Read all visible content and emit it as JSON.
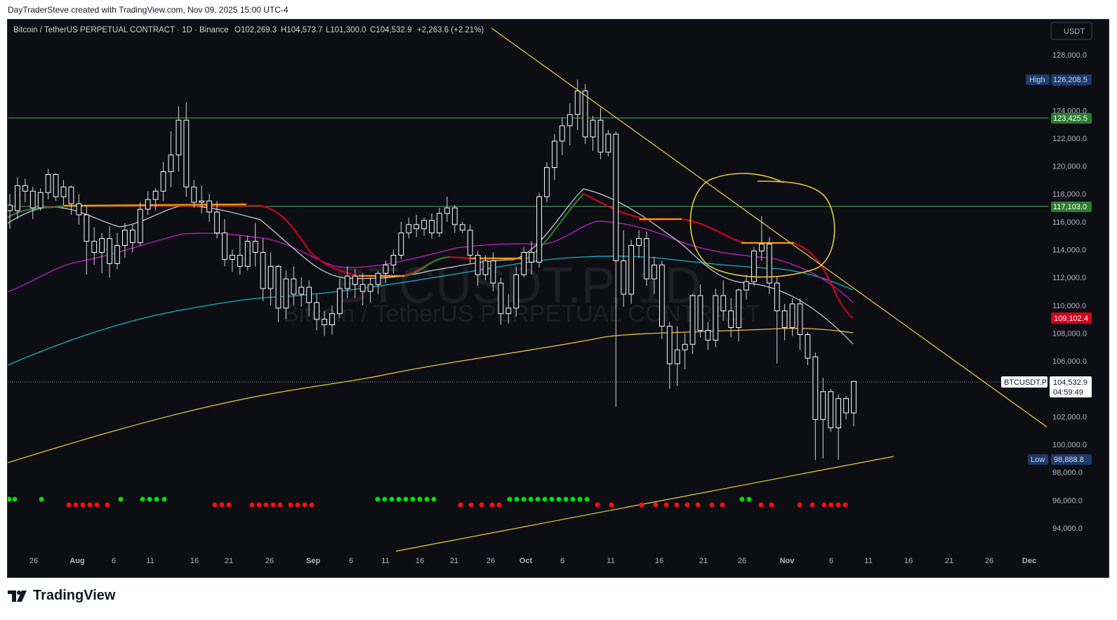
{
  "header": {
    "credit": "DayTraderSteve created with TradingView.com, Nov 09, 2025 15:00 UTC-4"
  },
  "legend": {
    "symbol": "Bitcoin / TetherUS PERPETUAL CONTRACT · 1D · Binance",
    "open": "O102,269.3",
    "high": "H104,573.7",
    "low": "L101,300.0",
    "close": "C104,532.9",
    "change": "+2,263.6 (+2.21%)"
  },
  "currency_button": "USDT",
  "watermark": {
    "ticker": "BTCUSDT.P, 1D",
    "name": "Bitcoin / TetherUS PERPETUAL CONTRACT"
  },
  "labels": {
    "high_tag": "High",
    "high_value": "126,208.5",
    "low_tag": "Low",
    "low_value": "98,888.8",
    "line_1": "123,425.5",
    "line_2": "117,103.0",
    "ma_red": "109,102.4",
    "symbol_tag": "BTCUSDT.P",
    "last_price": "104,532.9",
    "countdown": "04:59:49"
  },
  "colors": {
    "background": "#0c0e14",
    "up": "#ffffff",
    "down": "#ffffff",
    "trendline": "#f5d33c",
    "level": "#4caf50",
    "ma_red": "#d0021b",
    "ma_orange": "#ff9800",
    "ma_green": "#2e7d32",
    "ma_magenta": "#c51fc5",
    "ma_cyan": "#1ab0c8",
    "ma_yellow": "#e6c440"
  },
  "chart_data": {
    "type": "candlestick",
    "symbol": "BTCUSDT.P",
    "timeframe": "1D",
    "y_ticks": [
      "128,000.0",
      "126,000.0",
      "124,000.0",
      "122,000.0",
      "120,000.0",
      "118,000.0",
      "116,000.0",
      "114,000.0",
      "112,000.0",
      "110,000.0",
      "108,000.0",
      "106,000.0",
      "104,000.0",
      "102,000.0",
      "100,000.0",
      "98,000.0",
      "96,000.0",
      "94,000.0"
    ],
    "x_ticks": [
      "26",
      "Aug",
      "6",
      "11",
      "16",
      "21",
      "26",
      "Sep",
      "6",
      "11",
      "16",
      "21",
      "26",
      "Oct",
      "6",
      "11",
      "16",
      "21",
      "26",
      "Nov",
      "6",
      "11",
      "16",
      "21",
      "26",
      "Dec"
    ],
    "ylim": [
      93000,
      129500
    ],
    "horizontal_levels": [
      123425.5,
      117103.0
    ],
    "last_close": 104532.9,
    "candles": [
      [
        117200,
        118000,
        115500,
        116800
      ],
      [
        116800,
        119200,
        116200,
        118600
      ],
      [
        118600,
        119100,
        117400,
        118200
      ],
      [
        118200,
        118500,
        116200,
        117000
      ],
      [
        117000,
        118400,
        116800,
        118100
      ],
      [
        118100,
        119800,
        117600,
        119400
      ],
      [
        119400,
        119500,
        117500,
        117800
      ],
      [
        117800,
        119000,
        117200,
        118500
      ],
      [
        118500,
        118600,
        116500,
        117300
      ],
      [
        117300,
        118000,
        115800,
        116500
      ],
      [
        116500,
        117200,
        112200,
        114600
      ],
      [
        114600,
        115600,
        112900,
        113800
      ],
      [
        113800,
        115200,
        112300,
        114800
      ],
      [
        114800,
        115700,
        112000,
        113000
      ],
      [
        113000,
        115200,
        112600,
        114300
      ],
      [
        114300,
        115900,
        113400,
        115400
      ],
      [
        115400,
        115800,
        113800,
        114500
      ],
      [
        114500,
        117400,
        114300,
        116900
      ],
      [
        116900,
        118200,
        116500,
        117600
      ],
      [
        117600,
        118400,
        116800,
        118200
      ],
      [
        118200,
        120300,
        117500,
        119600
      ],
      [
        119600,
        122500,
        118500,
        120800
      ],
      [
        120800,
        124300,
        119600,
        123300
      ],
      [
        123300,
        124600,
        117800,
        118500
      ],
      [
        118500,
        119000,
        117000,
        117400
      ],
      [
        117400,
        118600,
        116600,
        117500
      ],
      [
        117500,
        118000,
        116000,
        116700
      ],
      [
        116700,
        117500,
        114800,
        115200
      ],
      [
        115200,
        116200,
        112800,
        113300
      ],
      [
        113300,
        114000,
        112400,
        113600
      ],
      [
        113600,
        115000,
        112200,
        112800
      ],
      [
        112800,
        115000,
        112500,
        114600
      ],
      [
        114600,
        115900,
        112800,
        113800
      ],
      [
        113800,
        114800,
        110300,
        111200
      ],
      [
        111200,
        113800,
        110000,
        112800
      ],
      [
        112800,
        112900,
        108800,
        109800
      ],
      [
        109800,
        112500,
        109000,
        111900
      ],
      [
        111900,
        112800,
        110000,
        110800
      ],
      [
        110800,
        112000,
        109900,
        111300
      ],
      [
        111300,
        111800,
        109200,
        110200
      ],
      [
        110200,
        110800,
        108200,
        109000
      ],
      [
        109000,
        109600,
        107800,
        108600
      ],
      [
        108600,
        110000,
        107900,
        109400
      ],
      [
        109400,
        111900,
        109100,
        111200
      ],
      [
        111200,
        112800,
        110500,
        112100
      ],
      [
        112100,
        112600,
        110500,
        111500
      ],
      [
        111500,
        112300,
        110000,
        111000
      ],
      [
        111000,
        112000,
        110200,
        111500
      ],
      [
        111500,
        112500,
        110800,
        112300
      ],
      [
        112300,
        113200,
        111600,
        112900
      ],
      [
        112900,
        114000,
        112300,
        113600
      ],
      [
        113600,
        116000,
        113300,
        115200
      ],
      [
        115200,
        116300,
        114800,
        115800
      ],
      [
        115800,
        116500,
        114900,
        115500
      ],
      [
        115500,
        116300,
        115000,
        116100
      ],
      [
        116100,
        116600,
        114800,
        115200
      ],
      [
        115200,
        117000,
        114900,
        116600
      ],
      [
        116600,
        117800,
        116000,
        117000
      ],
      [
        117000,
        117200,
        115200,
        115800
      ],
      [
        115800,
        116000,
        115200,
        115400
      ],
      [
        115400,
        115800,
        113000,
        113600
      ],
      [
        113600,
        113900,
        111400,
        112200
      ],
      [
        112200,
        113600,
        111800,
        113200
      ],
      [
        113200,
        113800,
        111000,
        111600
      ],
      [
        111600,
        112000,
        108600,
        109400
      ],
      [
        109400,
        110800,
        108700,
        109800
      ],
      [
        109800,
        112800,
        109200,
        112200
      ],
      [
        112200,
        114200,
        112000,
        113800
      ],
      [
        113800,
        114600,
        112200,
        113100
      ],
      [
        113100,
        118100,
        112700,
        117800
      ],
      [
        117800,
        120300,
        117400,
        119900
      ],
      [
        119900,
        122300,
        119000,
        121800
      ],
      [
        121800,
        123500,
        120800,
        122900
      ],
      [
        122900,
        124500,
        121500,
        123700
      ],
      [
        123700,
        126208.5,
        122600,
        125400
      ],
      [
        125400,
        125900,
        121600,
        122100
      ],
      [
        122100,
        123600,
        121100,
        123300
      ],
      [
        123300,
        124200,
        120500,
        121000
      ],
      [
        121000,
        122600,
        120700,
        122300
      ],
      [
        122300,
        122500,
        102700,
        113200
      ],
      [
        113200,
        115400,
        109900,
        110800
      ],
      [
        110800,
        114700,
        110100,
        114300
      ],
      [
        114300,
        115400,
        113400,
        114800
      ],
      [
        114800,
        115300,
        111400,
        111900
      ],
      [
        111900,
        113500,
        110800,
        112900
      ],
      [
        112900,
        113200,
        107600,
        108500
      ],
      [
        108500,
        108800,
        104000,
        105800
      ],
      [
        105800,
        108500,
        104200,
        106800
      ],
      [
        106800,
        108000,
        105400,
        107200
      ],
      [
        107200,
        110800,
        106500,
        110700
      ],
      [
        110700,
        111500,
        107700,
        108200
      ],
      [
        108200,
        108800,
        106800,
        107500
      ],
      [
        107500,
        111200,
        107000,
        110700
      ],
      [
        110700,
        111800,
        108900,
        109600
      ],
      [
        109600,
        110500,
        107700,
        108400
      ],
      [
        108400,
        111200,
        107400,
        111100
      ],
      [
        111100,
        112200,
        110400,
        111700
      ],
      [
        111700,
        114200,
        111400,
        113900
      ],
      [
        113900,
        116400,
        113200,
        114400
      ],
      [
        114400,
        114900,
        110800,
        111600
      ],
      [
        111600,
        112100,
        105800,
        109600
      ],
      [
        109600,
        110100,
        107500,
        108400
      ],
      [
        108400,
        110500,
        107800,
        110100
      ],
      [
        110100,
        110500,
        106800,
        107900
      ],
      [
        107900,
        108100,
        105700,
        106200
      ],
      [
        106300,
        106600,
        98888.8,
        101800
      ],
      [
        101800,
        104800,
        99000,
        103800
      ],
      [
        103800,
        104000,
        100900,
        101200
      ],
      [
        101200,
        103600,
        98900,
        103300
      ],
      [
        103300,
        103500,
        101800,
        102270
      ],
      [
        102269.3,
        104573.7,
        101300,
        104532.9
      ]
    ]
  }
}
